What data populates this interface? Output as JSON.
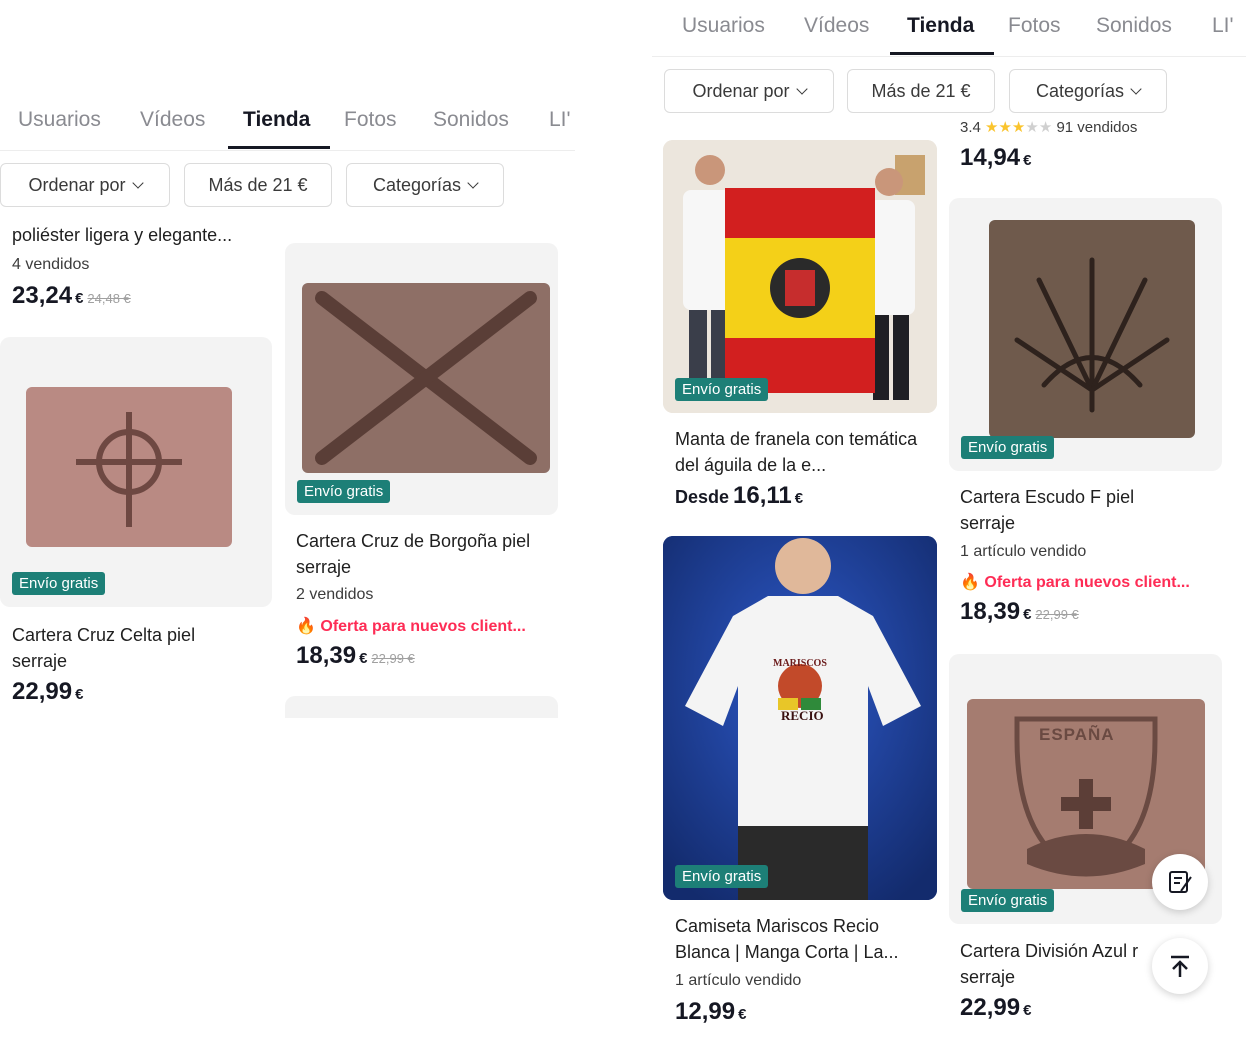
{
  "left": {
    "tabs": [
      "Usuarios",
      "Vídeos",
      "Tienda",
      "Fotos",
      "Sonidos",
      "LI'"
    ],
    "filters": [
      "Ordenar por",
      "Más de 21 €",
      "Categorías"
    ],
    "partial_item": {
      "title": "poliéster ligera y elegante...",
      "sold": "4 vendidos",
      "price": "23,24",
      "currency": "€",
      "old_price": "24,48 €"
    },
    "item1": {
      "badge": "Envío gratis",
      "title": "Cartera Cruz Celta piel serraje",
      "price": "22,99",
      "currency": "€"
    },
    "item2": {
      "badge": "Envío gratis",
      "title": "Cartera Cruz de Borgoña piel serraje",
      "sold": "2 vendidos",
      "offer": "Oferta para nuevos client...",
      "price": "18,39",
      "currency": "€",
      "old_price": "22,99 €"
    }
  },
  "right": {
    "tabs": [
      "Usuarios",
      "Vídeos",
      "Tienda",
      "Fotos",
      "Sonidos",
      "LI'"
    ],
    "filters": [
      "Ordenar por",
      "Más de 21 €",
      "Categorías"
    ],
    "partial_top": {
      "rating": "3.4",
      "sold": "91 vendidos",
      "price": "14,94",
      "currency": "€"
    },
    "item_blanket": {
      "badge": "Envío gratis",
      "title": "Manta de franela con temática del águila de la e...",
      "price_prefix": "Desde",
      "price": "16,11",
      "currency": "€"
    },
    "item_wallet_f": {
      "badge": "Envío gratis",
      "title": "Cartera Escudo F piel serraje",
      "sold": "1 artículo vendido",
      "offer": "Oferta para nuevos client...",
      "price": "18,39",
      "currency": "€",
      "old_price": "22,99 €"
    },
    "item_tshirt": {
      "badge": "Envío gratis",
      "title": "Camiseta Mariscos Recio Blanca | Manga Corta | La...",
      "sold": "1 artículo vendido",
      "price": "12,99",
      "currency": "€",
      "shirt_text_top": "MARISCOS",
      "shirt_text_bottom": "RECIO"
    },
    "item_wallet_div": {
      "badge": "Envío gratis",
      "title": "Cartera División Azul r serraje",
      "price": "22,99",
      "currency": "€",
      "wallet_text": "ESPAÑA"
    }
  },
  "colors": {
    "accent_offer": "#fe2c55",
    "badge": "#1d7f77"
  },
  "icons": [
    "chevron-down-icon",
    "fire-icon",
    "star-icon",
    "edit-note-icon",
    "scroll-to-top-icon"
  ]
}
